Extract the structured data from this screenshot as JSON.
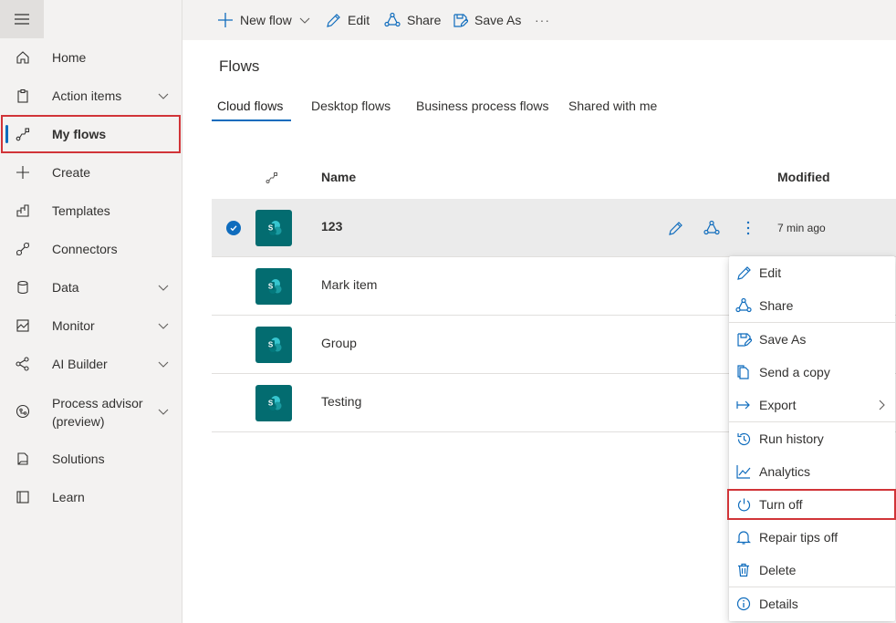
{
  "sidebar": {
    "items": [
      {
        "label": "Home",
        "icon": "home-icon",
        "chevron": false
      },
      {
        "label": "Action items",
        "icon": "clipboard-icon",
        "chevron": true
      },
      {
        "label": "My flows",
        "icon": "flow-icon",
        "chevron": false,
        "active": true
      },
      {
        "label": "Create",
        "icon": "plus-icon",
        "chevron": false
      },
      {
        "label": "Templates",
        "icon": "templates-icon",
        "chevron": false
      },
      {
        "label": "Connectors",
        "icon": "connector-icon",
        "chevron": false
      },
      {
        "label": "Data",
        "icon": "database-icon",
        "chevron": true
      },
      {
        "label": "Monitor",
        "icon": "monitor-icon",
        "chevron": true
      },
      {
        "label": "AI Builder",
        "icon": "ai-builder-icon",
        "chevron": true
      },
      {
        "label_line1": "Process advisor",
        "label_line2": "(preview)",
        "icon": "process-advisor-icon",
        "chevron": true
      },
      {
        "label": "Solutions",
        "icon": "solutions-icon",
        "chevron": false
      },
      {
        "label": "Learn",
        "icon": "book-icon",
        "chevron": false
      }
    ]
  },
  "toolbar": {
    "new_flow": "New flow",
    "edit": "Edit",
    "share": "Share",
    "save_as": "Save As",
    "more": "···"
  },
  "main": {
    "title": "Flows",
    "tabs": [
      {
        "label": "Cloud flows",
        "selected": true
      },
      {
        "label": "Desktop flows"
      },
      {
        "label": "Business process flows"
      },
      {
        "label": "Shared with me"
      }
    ],
    "columns": {
      "name": "Name",
      "modified": "Modified"
    },
    "rows": [
      {
        "name": "123",
        "modified": "7 min ago",
        "selected": true
      },
      {
        "name": "Mark item"
      },
      {
        "name": "Group"
      },
      {
        "name": "Testing"
      }
    ]
  },
  "context_menu": {
    "items": [
      {
        "label": "Edit",
        "icon": "pencil-icon"
      },
      {
        "label": "Share",
        "icon": "share-icon"
      },
      {
        "label": "Save As",
        "icon": "save-as-icon"
      },
      {
        "label": "Send a copy",
        "icon": "copy-icon"
      },
      {
        "label": "Export",
        "icon": "export-icon",
        "submenu": true
      },
      {
        "label": "Run history",
        "icon": "history-icon"
      },
      {
        "label": "Analytics",
        "icon": "analytics-icon"
      },
      {
        "label": "Turn off",
        "icon": "power-icon",
        "highlighted": true
      },
      {
        "label": "Repair tips off",
        "icon": "bell-icon"
      },
      {
        "label": "Delete",
        "icon": "trash-icon"
      },
      {
        "label": "Details",
        "icon": "info-icon"
      }
    ]
  },
  "colors": {
    "accent": "#0f6cbd",
    "highlight_border": "#d13438",
    "sharepoint_tile": "#036c70",
    "sidebar_bg": "#f3f2f1"
  }
}
